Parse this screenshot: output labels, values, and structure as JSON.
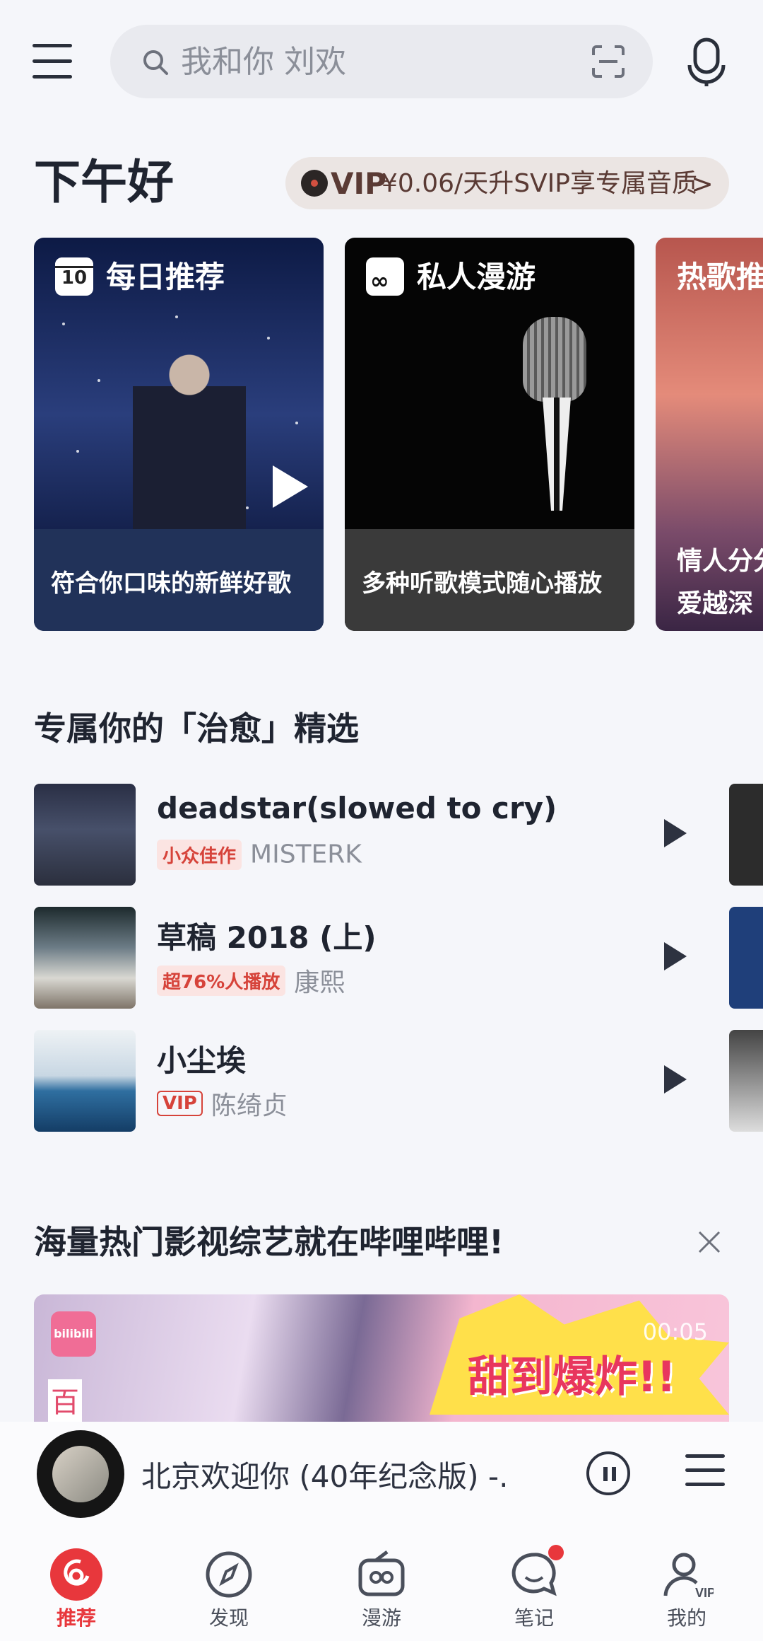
{
  "search": {
    "placeholder": "我和你 刘欢"
  },
  "greeting": "下午好",
  "vip_banner": {
    "tag": "VIP",
    "text": "¥0.06/天升SVIP享专属音质",
    "arrow": ">"
  },
  "cards": [
    {
      "badge": "10",
      "title": "每日推荐",
      "caption": "符合你口味的新鲜好歌"
    },
    {
      "badge": "∞",
      "title": "私人漫游",
      "caption": "多种听歌模式随心播放"
    },
    {
      "title": "热歌推",
      "line1": "情人分分",
      "line2": "爱越深"
    }
  ],
  "section": {
    "title": "专属你的「治愈」精选",
    "songs": [
      {
        "title": "deadstar(slowed to cry)",
        "tag": "小众佳作",
        "artist": "MISTERK"
      },
      {
        "title": "草稿 2018 (上)",
        "tag": "超76%人播放",
        "artist": "康熙"
      },
      {
        "title": "小尘埃",
        "tag": "VIP",
        "artist": "陈绮贞"
      }
    ]
  },
  "ad": {
    "title": "海量热门影视综艺就在哔哩哔哩!",
    "logo": "bilibili",
    "timer": "00:05",
    "slogan": "甜到爆炸!!",
    "char": "百"
  },
  "player": {
    "title": "北京欢迎你 (40年纪念版) -..."
  },
  "nav": [
    {
      "label": "推荐",
      "icon": "netease-music-icon",
      "active": true
    },
    {
      "label": "发现",
      "icon": "compass-icon"
    },
    {
      "label": "漫游",
      "icon": "radio-icon"
    },
    {
      "label": "笔记",
      "icon": "chat-bubble-icon"
    },
    {
      "label": "我的",
      "icon": "user-vip-icon"
    }
  ],
  "colors": {
    "accent": "#e8373c",
    "background": "#f5f6fa",
    "tag_red": "#d6433a"
  }
}
